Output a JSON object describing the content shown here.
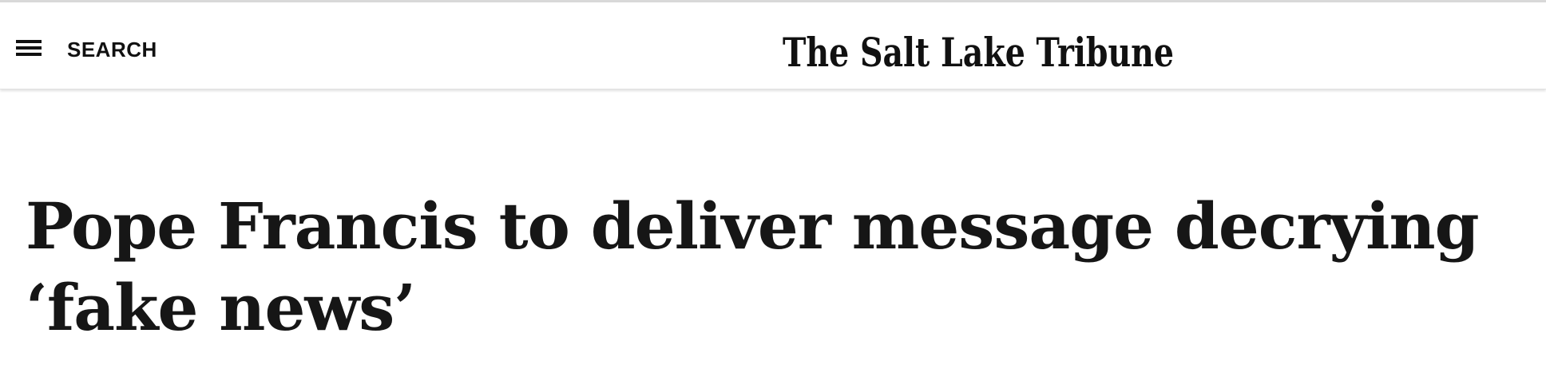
{
  "header": {
    "menu_icon": "hamburger-menu-icon",
    "search_label": "SEARCH",
    "masthead": "The Salt Lake Tribune"
  },
  "article": {
    "headline": "Pope Francis to deliver message decrying ‘fake news’"
  },
  "colors": {
    "text": "#161616",
    "background": "#ffffff",
    "divider": "#d9d9d9"
  }
}
